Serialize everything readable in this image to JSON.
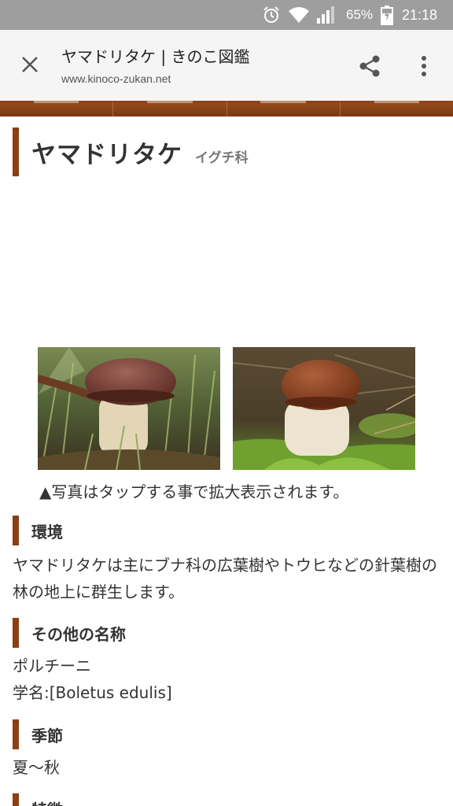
{
  "status_bar": {
    "battery_percent": "65%",
    "time": "21:18",
    "icons": [
      "alarm-icon",
      "wifi-icon",
      "signal-icon",
      "battery-charging-icon"
    ]
  },
  "toolbar": {
    "title": "ヤマドリタケ | きのこ図鑑",
    "url": "www.kinoco-zukan.net",
    "icons": [
      "close-icon",
      "share-icon",
      "more-vert-icon"
    ]
  },
  "colors": {
    "accent_brown": "#8b3f12",
    "nav_brown": "#7a3a12",
    "status_bar_gray": "#9e9e9e"
  },
  "page": {
    "name": "ヤマドリタケ",
    "family": "イグチ科",
    "photo_caption": "▲写真はタップする事で拡大表示されます。",
    "sections": {
      "habitat": {
        "heading": "環境",
        "text": "ヤマドリタケは主にブナ科の広葉樹やトウヒなどの針葉樹の林の地上に群生します。"
      },
      "other_names": {
        "heading": "その他の名称",
        "line1": "ポルチーニ",
        "line2": "学名:[Boletus edulis]"
      },
      "season": {
        "heading": "季節",
        "text": "夏〜秋"
      },
      "features": {
        "heading": "特徴"
      }
    }
  }
}
